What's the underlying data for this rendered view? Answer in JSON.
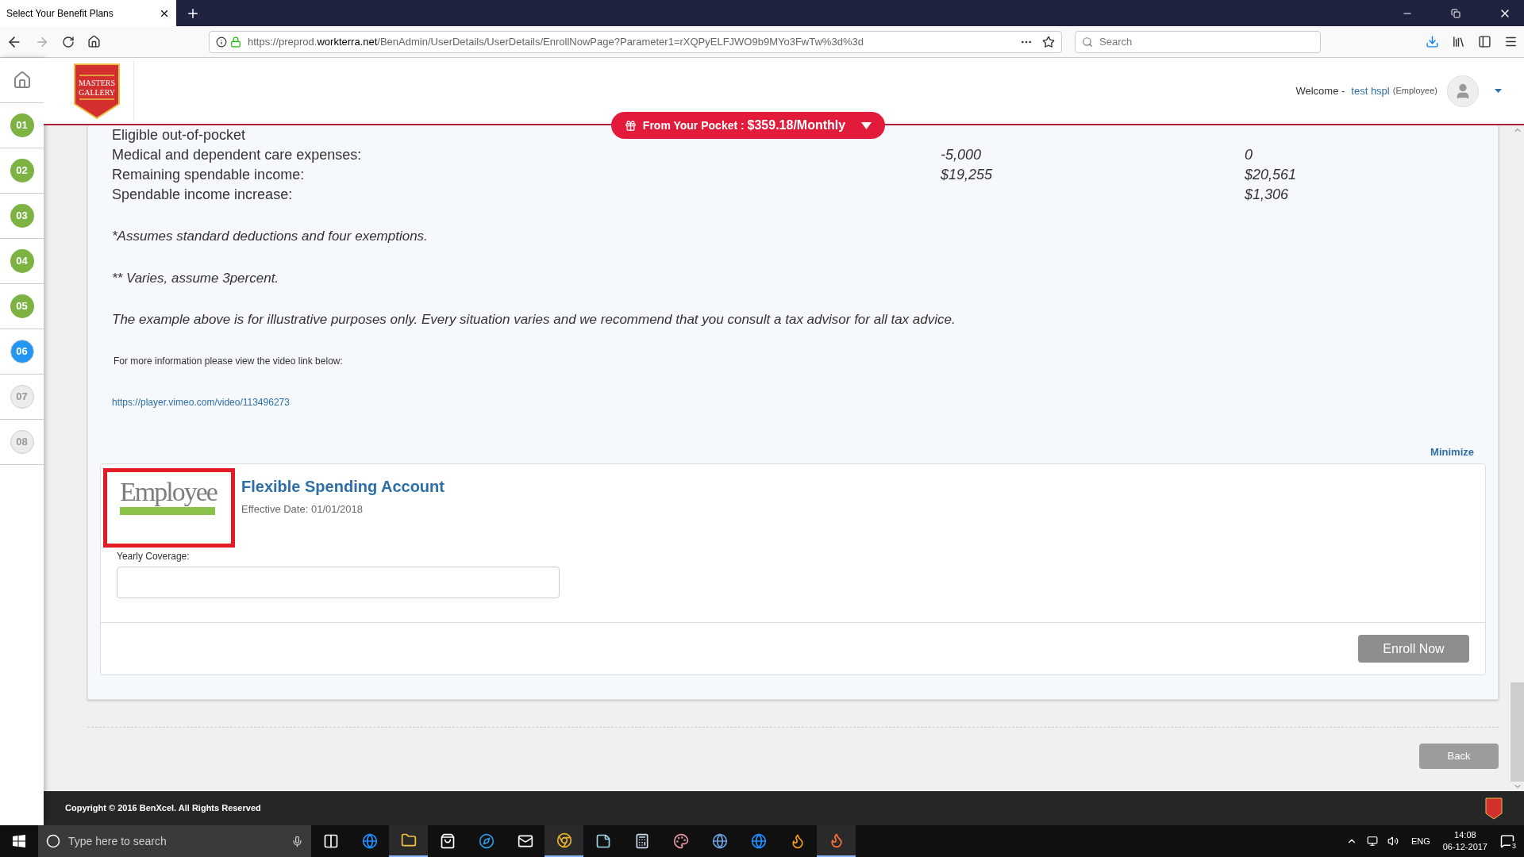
{
  "browser": {
    "tab_title": "Select Your Benefit Plans",
    "url_prefix": "https://preprod.",
    "url_domain": "workterra.net",
    "url_path": "/BenAdmin/UserDetails/UserDetails/EnrollNowPage?Parameter1=rXQPyELFJWO9b9MYo3FwTw%3d%3d",
    "search_placeholder": "Search"
  },
  "steps": [
    {
      "label": "01",
      "completed": true,
      "selected": false
    },
    {
      "label": "02",
      "completed": true,
      "selected": false
    },
    {
      "label": "03",
      "completed": true,
      "selected": false
    },
    {
      "label": "04",
      "completed": true,
      "selected": false
    },
    {
      "label": "05",
      "completed": true,
      "selected": false
    },
    {
      "label": "06",
      "completed": false,
      "selected": true
    },
    {
      "label": "07",
      "completed": false,
      "selected": false
    },
    {
      "label": "08",
      "completed": false,
      "selected": false
    }
  ],
  "header": {
    "logo_lines": [
      "MASTERS",
      "GALLERY"
    ],
    "welcome": "Welcome -",
    "user": "test hspl",
    "role": "(Employee)"
  },
  "pocket": {
    "label": "From Your Pocket :",
    "amount": "$359.18/Monthly"
  },
  "table": {
    "rows": [
      {
        "label": "Eligible out-of-pocket"
      },
      {
        "label": "Medical and dependent care expenses:",
        "column_2": "-5,000",
        "column_3": "0"
      },
      {
        "label": "Remaining spendable income:",
        "column_2": "$19,255",
        "column_3": "$20,561"
      },
      {
        "label": "Spendable income increase:",
        "column_3": "$1,306"
      }
    ]
  },
  "notes": [
    "*Assumes standard deductions and four exemptions.",
    "** Varies, assume 3percent.",
    "The example above is for illustrative purposes only. Every situation varies and we recommend that you consult a tax advisor for all tax advice."
  ],
  "info_text": "For more information please view the video link below:",
  "video_link": "https://player.vimeo.com/video/113496273",
  "minimize": "Minimize",
  "plan": {
    "logo_text": "Employee",
    "title": "Flexible Spending Account",
    "effective": "Effective Date: 01/01/2018",
    "field_label": "Yearly Coverage:",
    "enroll": "Enroll Now"
  },
  "back": "Back",
  "footer": {
    "copyright": "Copyright © 2016 BenXcel. All Rights Reserved"
  },
  "taskbar": {
    "search_placeholder": "Type here to search",
    "apps": [
      {
        "kind": "task-view",
        "selected": false
      },
      {
        "kind": "browser-e",
        "selected": false
      },
      {
        "kind": "folder",
        "selected": true
      },
      {
        "kind": "store",
        "selected": false
      },
      {
        "kind": "compass",
        "selected": false
      },
      {
        "kind": "mail",
        "selected": false
      },
      {
        "kind": "chrome",
        "selected": true
      },
      {
        "kind": "notes",
        "selected": false
      },
      {
        "kind": "calculator",
        "selected": false
      },
      {
        "kind": "paint",
        "selected": false
      },
      {
        "kind": "globe",
        "selected": false
      },
      {
        "kind": "browser-e",
        "selected": false
      },
      {
        "kind": "flame",
        "selected": false
      },
      {
        "kind": "fox",
        "selected": true
      }
    ],
    "lang": "ENG",
    "time": "14:08",
    "date": "06-12-2017",
    "notifications": "3"
  }
}
